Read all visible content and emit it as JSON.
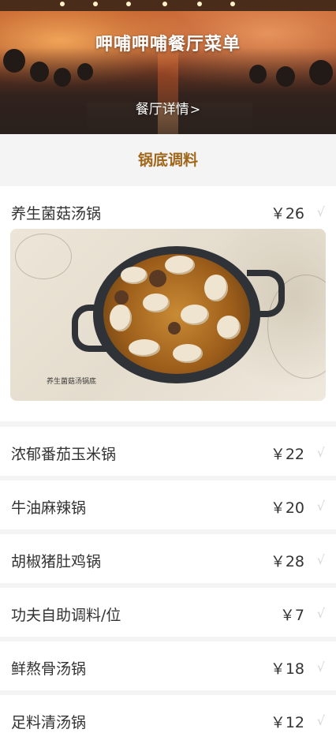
{
  "header": {
    "title": "呷哺呷哺餐厅菜单",
    "details_link": "餐厅详情",
    "chevron": ">"
  },
  "category": {
    "title": "锅底调料"
  },
  "featured_item": {
    "name": "养生菌菇汤锅",
    "price": "￥26",
    "check": "√",
    "image_caption": "养生菌菇汤锅底"
  },
  "items": [
    {
      "name": "浓郁番茄玉米锅",
      "price": "￥22",
      "check": "√"
    },
    {
      "name": "牛油麻辣锅",
      "price": "￥20",
      "check": "√"
    },
    {
      "name": "胡椒猪肚鸡锅",
      "price": "￥28",
      "check": "√"
    },
    {
      "name": "功夫自助调料/位",
      "price": "￥7",
      "check": "√"
    },
    {
      "name": "鲜熬骨汤锅",
      "price": "￥18",
      "check": "√"
    },
    {
      "name": "足料清汤锅",
      "price": "￥12",
      "check": "√"
    }
  ],
  "colors": {
    "accent": "#a0671b",
    "background": "#f4f4f4",
    "card": "#ffffff",
    "check": "#d6d6d6"
  }
}
